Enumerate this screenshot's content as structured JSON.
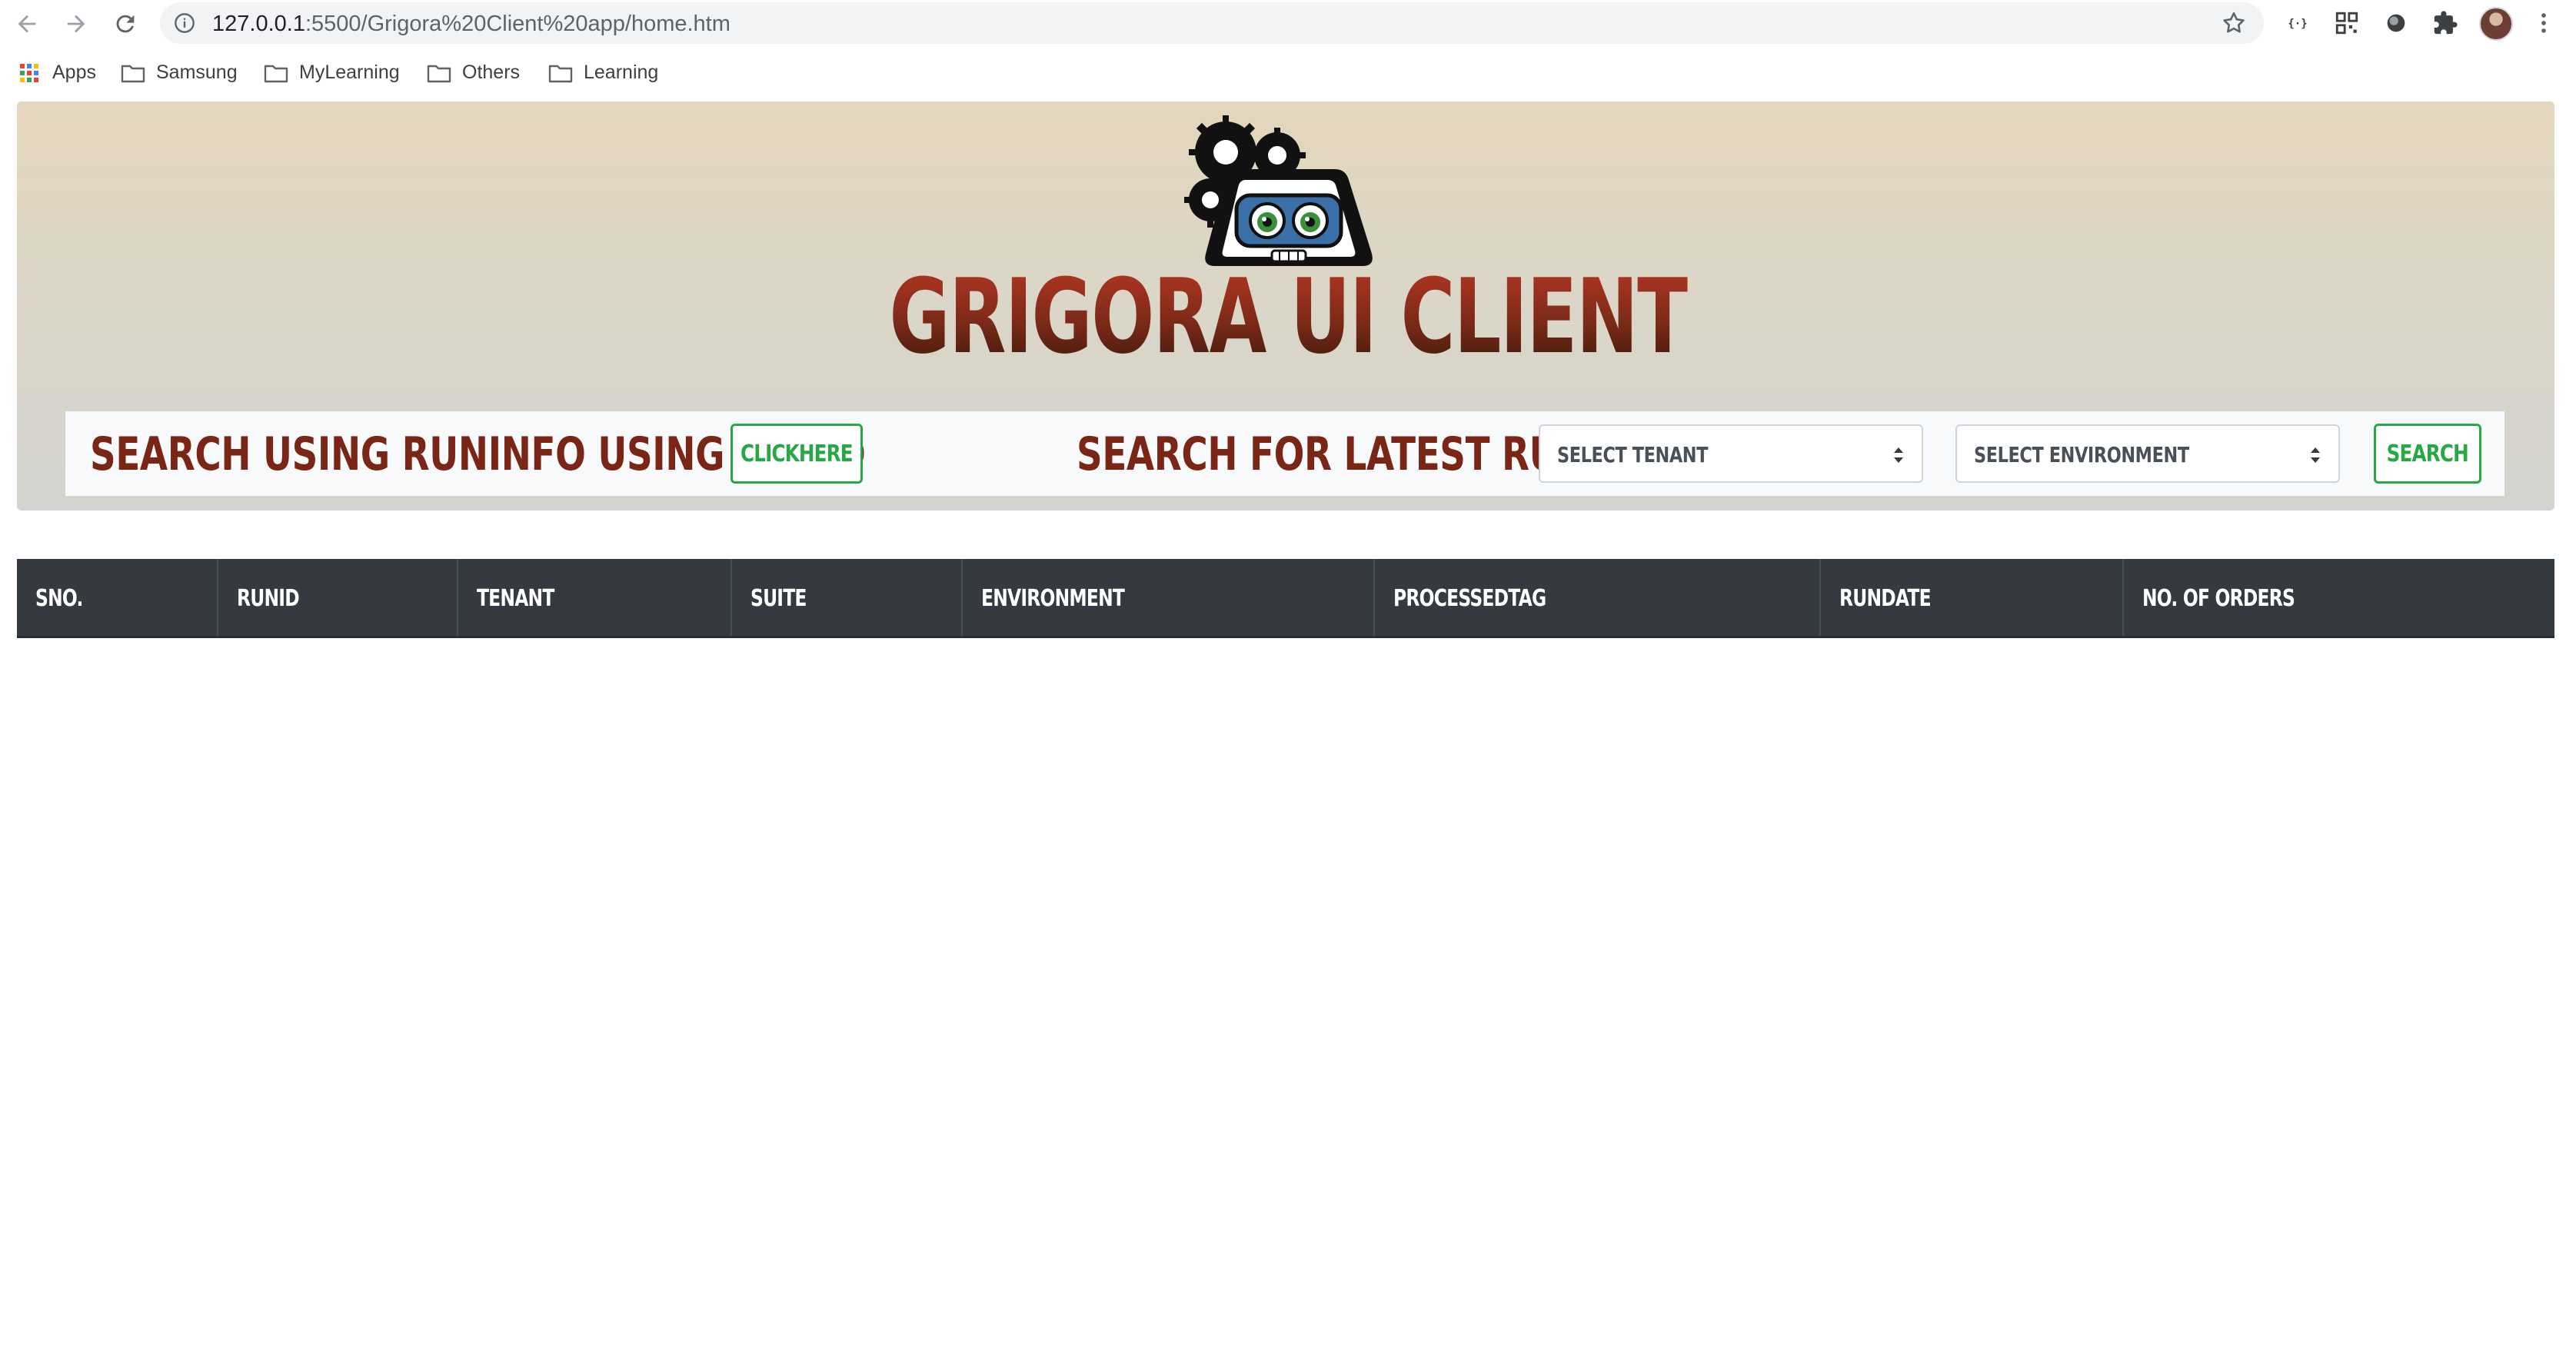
{
  "browser": {
    "url_host": "127.0.0.1",
    "url_rest": ":5500/Grigora%20Client%20app/home.htm",
    "bookmarks": [
      {
        "label": "Apps",
        "icon": "apps-grid-icon"
      },
      {
        "label": "Samsung",
        "icon": "folder-icon"
      },
      {
        "label": "MyLearning",
        "icon": "folder-icon"
      },
      {
        "label": "Others",
        "icon": "folder-icon"
      },
      {
        "label": "Learning",
        "icon": "folder-icon"
      }
    ],
    "extensions": [
      "json-viewer-icon",
      "qr-code-icon",
      "circle-extension-icon",
      "puzzle-icon"
    ]
  },
  "header": {
    "title": "GRIGORA UI CLIENT",
    "logo": "robot-gears-logo"
  },
  "search_bar": {
    "runinfo_heading": "SEARCH USING RUNINFO USING RUNID",
    "click_here_label": "CLICKHERE",
    "latest_heading": "SEARCH FOR LATEST RUNS",
    "tenant_select": {
      "selected": "SELECT TENANT"
    },
    "environment_select": {
      "selected": "SELECT ENVIRONMENT"
    },
    "search_label": "SEARCH"
  },
  "table": {
    "columns": [
      "SNO.",
      "RUNID",
      "TENANT",
      "SUITE",
      "ENVIRONMENT",
      "PROCESSEDTAG",
      "RUNDATE",
      "NO. OF ORDERS"
    ],
    "rows": []
  },
  "colors": {
    "title_red": "#7a2a1a",
    "success_green": "#28a745",
    "table_header_bg": "#343a40"
  }
}
